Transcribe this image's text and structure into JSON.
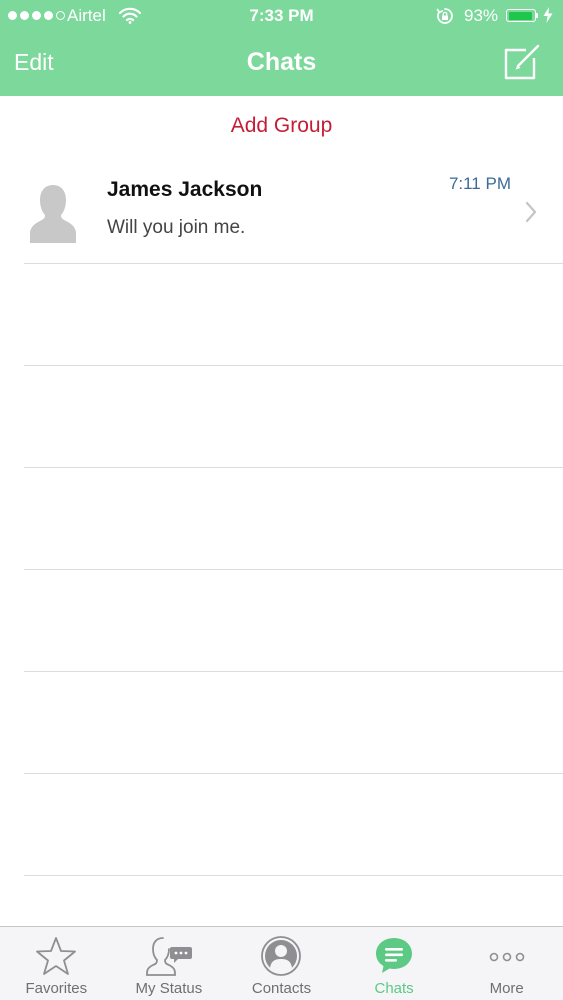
{
  "status_bar": {
    "carrier": "Airtel",
    "time": "7:33 PM",
    "battery_percent": "93%",
    "battery_level": 0.93,
    "signal_bars_filled": 4,
    "signal_bars_total": 5
  },
  "nav": {
    "edit_label": "Edit",
    "title": "Chats",
    "compose_icon": "compose-icon"
  },
  "add_group_label": "Add Group",
  "chats": [
    {
      "name": "James Jackson",
      "preview": "Will you join me.",
      "time": "7:11 PM",
      "avatar_icon": "person-silhouette-icon"
    }
  ],
  "tabs": [
    {
      "label": "Favorites",
      "icon": "star-icon",
      "active": false
    },
    {
      "label": "My Status",
      "icon": "status-icon",
      "active": false
    },
    {
      "label": "Contacts",
      "icon": "contacts-icon",
      "active": false
    },
    {
      "label": "Chats",
      "icon": "chat-bubble-icon",
      "active": true
    },
    {
      "label": "More",
      "icon": "more-dots-icon",
      "active": false
    }
  ],
  "colors": {
    "header_bg": "#7dd89b",
    "accent_red": "#c61d37",
    "time_blue": "#3e6b93",
    "active_tab": "#5cc984",
    "tab_bar_bg": "#f5f5f7"
  }
}
